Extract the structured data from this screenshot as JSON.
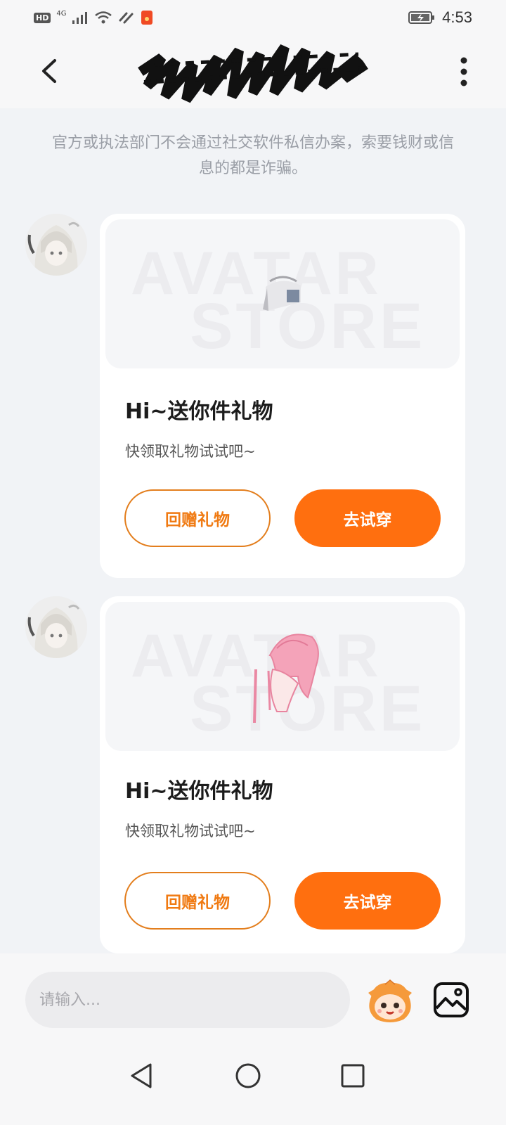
{
  "status_bar": {
    "left_badges": [
      "HD",
      "4G"
    ],
    "time": "4:53",
    "icons": [
      "signal-icon",
      "wifi-icon",
      "no-disturb-icon",
      "app-notification-icon",
      "battery-charging-icon"
    ]
  },
  "header": {
    "back_icon": "back-arrow-icon",
    "more_icon": "more-vertical-icon"
  },
  "notice": "官方或执法部门不会通过社交软件私信办案，索要钱财或信息的都是诈骗。",
  "messages": [
    {
      "watermark_top": "AVATAR",
      "watermark_bottom": "STORE",
      "item_icon": "hat-item-icon",
      "title": "Hi~送你件礼物",
      "subtitle": "快领取礼物试试吧~",
      "return_gift_label": "回赠礼物",
      "try_on_label": "去试穿"
    },
    {
      "watermark_top": "AVATAR",
      "watermark_bottom": "STORE",
      "item_icon": "pink-hair-item-icon",
      "title": "Hi~送你件礼物",
      "subtitle": "快领取礼物试试吧~",
      "return_gift_label": "回赠礼物",
      "try_on_label": "去试穿"
    }
  ],
  "composer": {
    "placeholder": "请输入...",
    "mascot_icon": "mascot-emoji-icon",
    "image_icon": "image-picker-icon"
  },
  "colors": {
    "accent": "#ff6f0f",
    "accent_outline": "#e37e1d",
    "background": "#f1f3f6"
  }
}
